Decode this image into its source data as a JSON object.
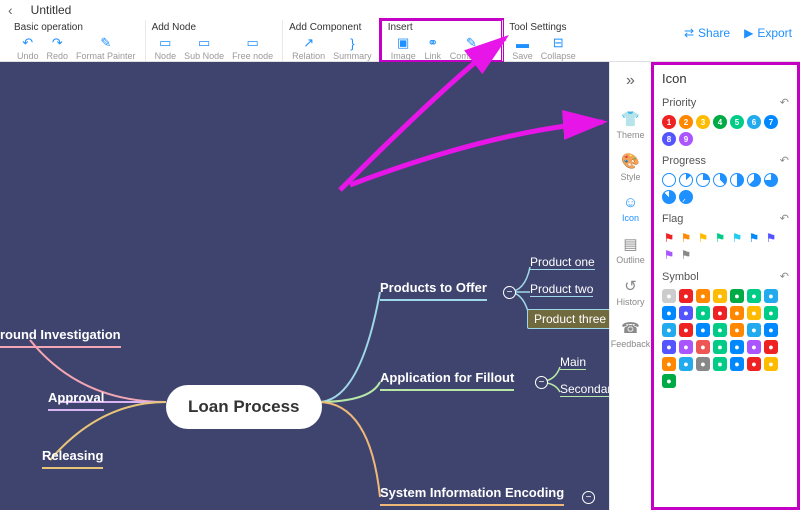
{
  "title": "Untitled",
  "toolbar": {
    "groups": [
      {
        "title": "Basic operation",
        "items": [
          {
            "n": "undo",
            "l": "Undo",
            "i": "↶"
          },
          {
            "n": "redo",
            "l": "Redo",
            "i": "↷"
          },
          {
            "n": "format-painter",
            "l": "Format Painter",
            "i": "✎"
          }
        ]
      },
      {
        "title": "Add Node",
        "items": [
          {
            "n": "node",
            "l": "Node",
            "i": "▭"
          },
          {
            "n": "sub-node",
            "l": "Sub Node",
            "i": "▭"
          },
          {
            "n": "free-node",
            "l": "Free node",
            "i": "▭"
          }
        ]
      },
      {
        "title": "Add Component",
        "items": [
          {
            "n": "relation",
            "l": "Relation",
            "i": "↗"
          },
          {
            "n": "summary",
            "l": "Summary",
            "i": "}"
          }
        ]
      },
      {
        "title": "Insert",
        "highlight": true,
        "items": [
          {
            "n": "image",
            "l": "Image",
            "i": "▣"
          },
          {
            "n": "link",
            "l": "Link",
            "i": "⚭"
          },
          {
            "n": "comments",
            "l": "Comments",
            "i": "✎"
          }
        ]
      },
      {
        "title": "Tool Settings",
        "items": [
          {
            "n": "save",
            "l": "Save",
            "i": "▬"
          },
          {
            "n": "collapse",
            "l": "Collapse",
            "i": "⊟"
          }
        ]
      }
    ],
    "share": "Share",
    "export": "Export"
  },
  "mindmap": {
    "center": "Loan Process",
    "left": [
      {
        "label": "round Investigation",
        "color": "#f4a6b4"
      },
      {
        "label": "Approval",
        "color": "#d8b4f0"
      },
      {
        "label": "Releasing",
        "color": "#e8c478"
      }
    ],
    "right": [
      {
        "label": "Products to Offer",
        "color": "#9fd8e8",
        "children": [
          "Product one",
          "Product two",
          "Product three"
        ]
      },
      {
        "label": "Application for Fillout",
        "color": "#b8e8a8",
        "children": [
          "Main",
          "Secondary"
        ]
      },
      {
        "label": "System Information Encoding",
        "color": "#f0b878",
        "children": []
      }
    ]
  },
  "sidebar": {
    "items": [
      {
        "n": "theme",
        "l": "Theme",
        "i": "👕"
      },
      {
        "n": "style",
        "l": "Style",
        "i": "🎨"
      },
      {
        "n": "icon",
        "l": "Icon",
        "i": "☺",
        "active": true
      },
      {
        "n": "outline",
        "l": "Outline",
        "i": "▤"
      },
      {
        "n": "history",
        "l": "History",
        "i": "↺"
      },
      {
        "n": "feedback",
        "l": "Feedback",
        "i": "☎"
      }
    ]
  },
  "panel": {
    "title": "Icon",
    "priority": {
      "label": "Priority",
      "colors": [
        "#e22",
        "#f80",
        "#fb0",
        "#0a4",
        "#0c8",
        "#2ae",
        "#08f",
        "#55f",
        "#a5f"
      ]
    },
    "progress": {
      "label": "Progress"
    },
    "flag": {
      "label": "Flag",
      "colors": [
        "#e22",
        "#f80",
        "#fb0",
        "#0c8",
        "#2ce",
        "#08f",
        "#55f",
        "#a5f",
        "#888"
      ]
    },
    "symbol": {
      "label": "Symbol",
      "colors": [
        "#ccc",
        "#e22",
        "#f80",
        "#fb0",
        "#0a4",
        "#0c8",
        "#2ae",
        "#08f",
        "#55f",
        "#0c8",
        "#e22",
        "#f80",
        "#fb0",
        "#0c8",
        "#2ae",
        "#e22",
        "#08f",
        "#0c8",
        "#f80",
        "#2ae",
        "#08f",
        "#55f",
        "#a5f",
        "#e55",
        "#0c8",
        "#08f",
        "#a5f",
        "#e22",
        "#f80",
        "#2ae",
        "#888",
        "#0c8",
        "#08f",
        "#e22",
        "#fb0",
        "#0a4"
      ]
    }
  }
}
